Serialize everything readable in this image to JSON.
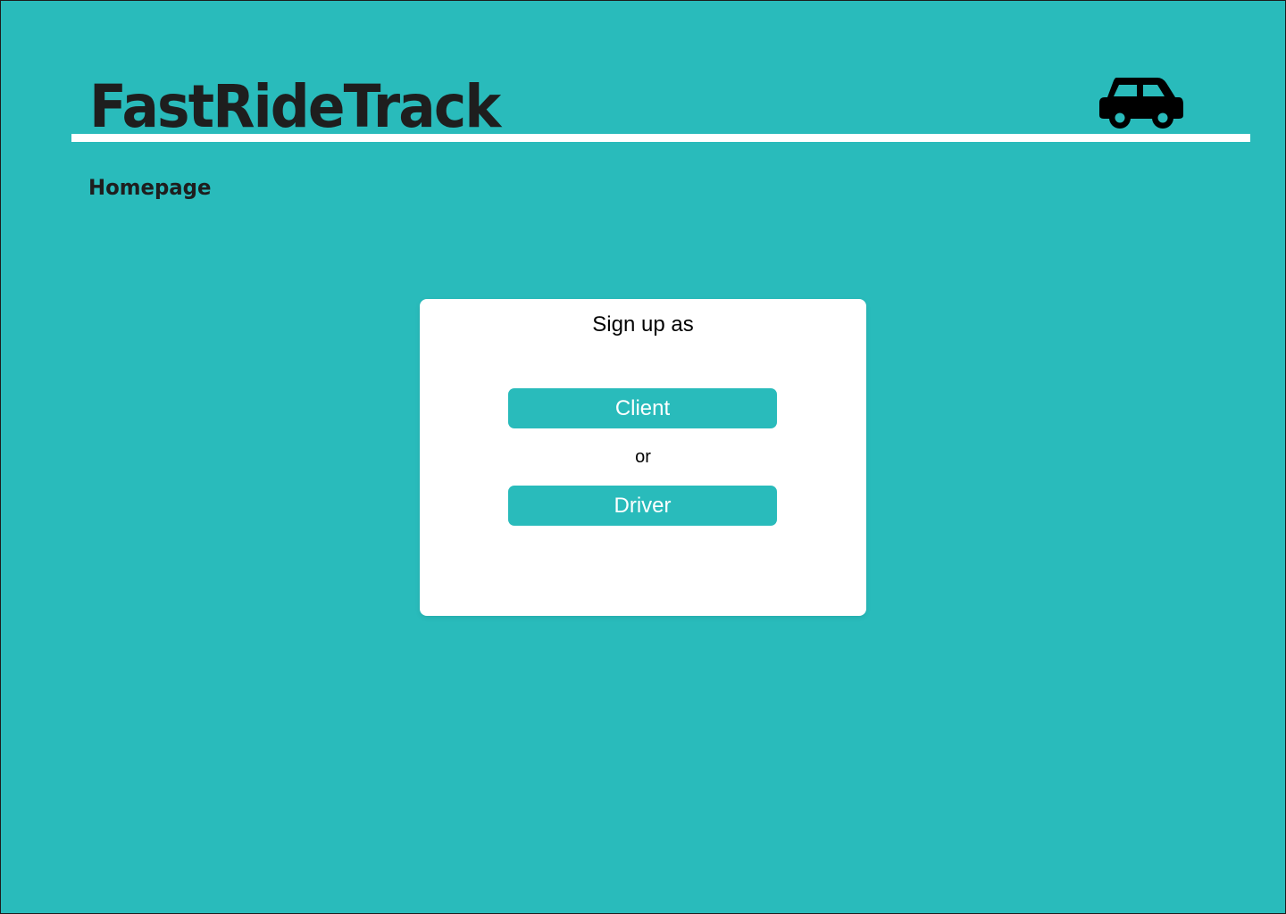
{
  "app": {
    "title": "FastRideTrack"
  },
  "header": {
    "logo_icon": "car-icon"
  },
  "breadcrumb": {
    "label": "Homepage"
  },
  "signup_card": {
    "title": "Sign up as",
    "client_label": "Client",
    "separator": "or",
    "driver_label": "Driver"
  },
  "colors": {
    "background": "#29bbbb",
    "accent": "#29bbbb",
    "card": "#ffffff",
    "text_dark": "#1e1e1e"
  }
}
